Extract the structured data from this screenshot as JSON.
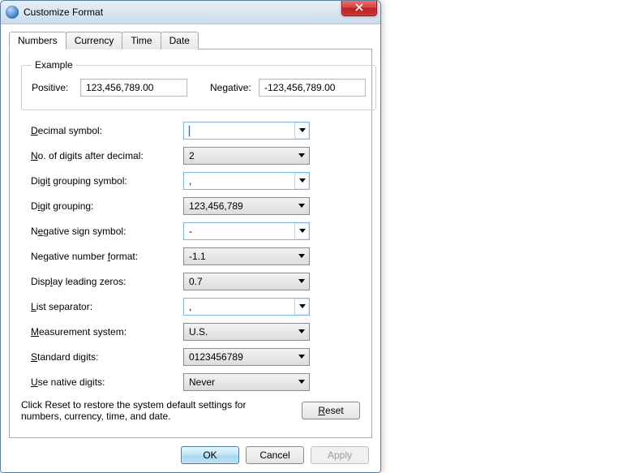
{
  "window": {
    "title": "Customize Format"
  },
  "tabs": [
    "Numbers",
    "Currency",
    "Time",
    "Date"
  ],
  "example": {
    "legend": "Example",
    "positive_label": "Positive:",
    "positive_value": "123,456,789.00",
    "negative_label": "Negative:",
    "negative_value": "-123,456,789.00"
  },
  "fields": {
    "decimal_symbol": {
      "label_html": "<span class='ul'>D</span>ecimal symbol:",
      "value": "",
      "editable": true
    },
    "digits_after_decimal": {
      "label_html": "<span class='ul'>N</span>o. of digits after decimal:",
      "value": "2",
      "editable": false
    },
    "digit_grouping_symbol": {
      "label_html": "Digi<span class='ul'>t</span> grouping symbol:",
      "value": ",",
      "editable": true
    },
    "digit_grouping": {
      "label_html": "D<span class='ul'>i</span>git grouping:",
      "value": "123,456,789",
      "editable": false
    },
    "negative_sign_symbol": {
      "label_html": "N<span class='ul'>e</span>gative sign symbol:",
      "value": "-",
      "editable": true
    },
    "negative_number_format": {
      "label_html": "Negative number <span class='ul'>f</span>ormat:",
      "value": "-1.1",
      "editable": false
    },
    "display_leading_zeros": {
      "label_html": "Disp<span class='ul'>l</span>ay leading zeros:",
      "value": "0.7",
      "editable": false
    },
    "list_separator": {
      "label_html": "<span class='ul'>L</span>ist separator:",
      "value": ",",
      "editable": true
    },
    "measurement_system": {
      "label_html": "<span class='ul'>M</span>easurement system:",
      "value": "U.S.",
      "editable": false
    },
    "standard_digits": {
      "label_html": "<span class='ul'>S</span>tandard digits:",
      "value": "0123456789",
      "editable": false
    },
    "use_native_digits": {
      "label_html": "<span class='ul'>U</span>se native digits:",
      "value": "Never",
      "editable": false
    }
  },
  "reset": {
    "desc": "Click Reset to restore the system default settings for numbers, currency, time, and date.",
    "label_html": "<span class='ul'>R</span>eset"
  },
  "buttons": {
    "ok": "OK",
    "cancel": "Cancel",
    "apply": "Apply"
  }
}
